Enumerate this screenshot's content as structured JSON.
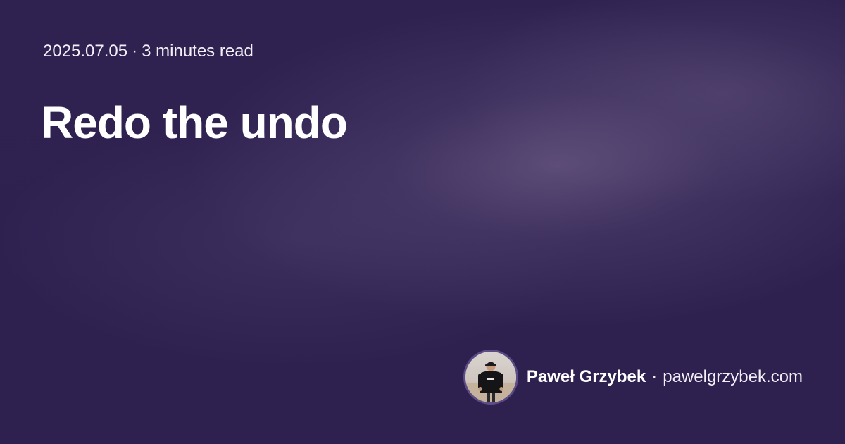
{
  "post": {
    "date": "2025.07.05",
    "separator": "·",
    "read_time": "3 minutes read",
    "title": "Redo the undo"
  },
  "author": {
    "name": "Paweł Grzybek",
    "separator": "·",
    "site": "pawelgrzybek.com",
    "avatar_icon": "author-photo"
  },
  "colors": {
    "background": "#2e2150",
    "text": "#ffffff",
    "avatar_border": "#5c4c86"
  }
}
